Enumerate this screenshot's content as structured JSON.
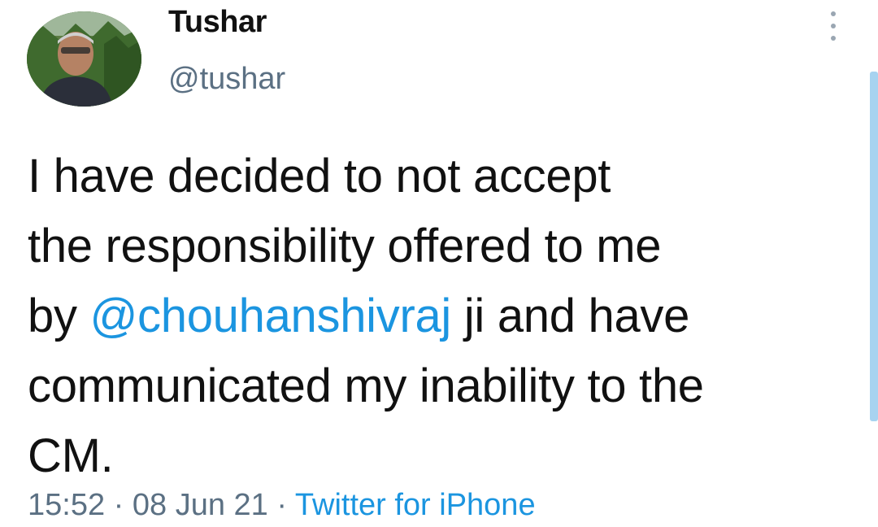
{
  "author": {
    "name": "Tushar",
    "handle": "@tushar"
  },
  "tweet": {
    "line1": "I have decided to not accept",
    "line2": "the responsibility offered to me",
    "line3_pre": "by ",
    "mention": "@chouhanshivraj",
    "line3_post": " ji and have",
    "line4": "communicated my inability to the",
    "line5": "CM."
  },
  "meta": {
    "time": "15:52",
    "separator": " · ",
    "date": "08 Jun 21",
    "source": "Twitter for iPhone"
  },
  "colors": {
    "text": "#111111",
    "secondary": "#5b7083",
    "link": "#1b95e0"
  },
  "icons": {
    "menu": "more-vertical-icon"
  }
}
